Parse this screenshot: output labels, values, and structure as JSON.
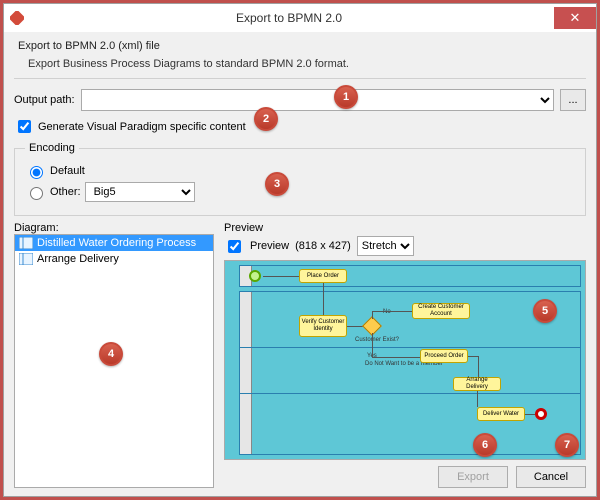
{
  "titlebar": {
    "title": "Export to BPMN 2.0"
  },
  "intro": {
    "title": "Export to BPMN 2.0 (xml) file",
    "desc": "Export Business Process Diagrams to standard BPMN 2.0 format."
  },
  "output": {
    "label": "Output path:",
    "value": "",
    "browse": "..."
  },
  "generate_chk": {
    "label": "Generate Visual Paradigm specific content",
    "checked": true
  },
  "encoding": {
    "legend": "Encoding",
    "default_label": "Default",
    "other_label": "Other:",
    "other_value": "Big5",
    "selected": "default"
  },
  "diagram": {
    "label": "Diagram:",
    "items": [
      {
        "label": "Distilled Water Ordering Process",
        "selected": true
      },
      {
        "label": "Arrange Delivery",
        "selected": false
      }
    ]
  },
  "preview": {
    "label": "Preview",
    "chk_label": "Preview",
    "chk_checked": true,
    "dims": "(818 x 427)",
    "mode": "Stretch",
    "tasks": {
      "place_order": "Place Order",
      "verify": "Verify Customer Identity",
      "create_acct": "Create Customer Account",
      "proceed": "Proceed Order",
      "arrange": "Arrange Delivery",
      "deliver": "Deliver Water"
    },
    "labels": {
      "exists": "Customer Exist?",
      "yes": "Yes",
      "no": "No",
      "donot": "Do Not Want to be a member"
    }
  },
  "buttons": {
    "export": "Export",
    "cancel": "Cancel"
  },
  "callouts": [
    "1",
    "2",
    "3",
    "4",
    "5",
    "6",
    "7"
  ]
}
